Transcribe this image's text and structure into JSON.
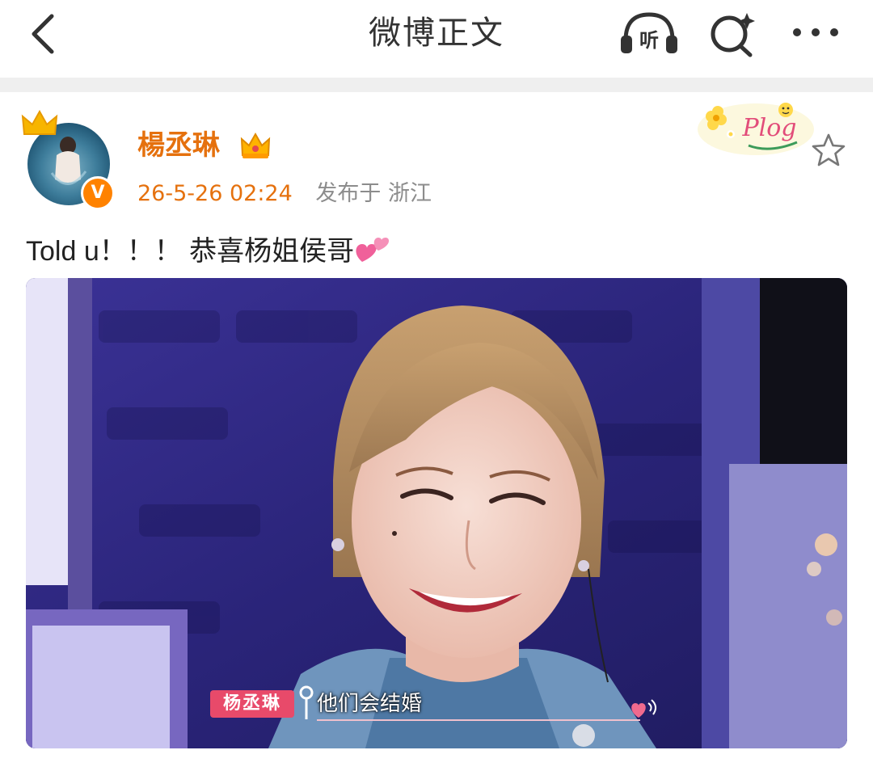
{
  "header": {
    "title": "微博正文",
    "listen_label": "听",
    "icons": [
      "back-icon",
      "listen-icon",
      "search-icon",
      "more-icon"
    ]
  },
  "author": {
    "name": "楊丞琳",
    "time": "26-5-26 02:24",
    "location": "发布于 浙江",
    "verified_badge": "V",
    "colors": {
      "name": "#e5710e",
      "badge": "#ff8200"
    }
  },
  "post": {
    "text": "Told u！！！ 恭喜杨姐侯哥",
    "emoji": "two-hearts-icon"
  },
  "decoration": {
    "plog_text": "Plog"
  },
  "photo": {
    "name_chip": "杨丞琳",
    "subtitle": "他们会结婚"
  }
}
